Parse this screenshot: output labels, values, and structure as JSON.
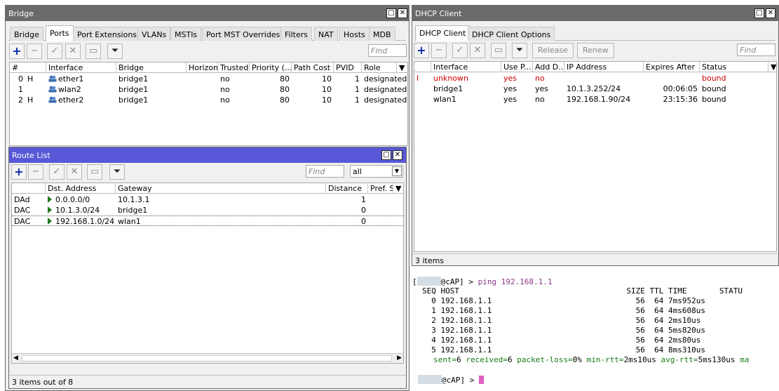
{
  "bridge": {
    "title": "Bridge",
    "tabs": [
      "Bridge",
      "Ports",
      "Port Extensions",
      "VLANs",
      "MSTIs",
      "Port MST Overrides",
      "Filters",
      "NAT",
      "Hosts",
      "MDB"
    ],
    "find_placeholder": "Find",
    "columns": [
      "#",
      "Interface",
      "Bridge",
      "Horizon",
      "Trusted",
      "Priority (...",
      "Path Cost",
      "PVID",
      "Role"
    ],
    "rows": [
      {
        "num": "0",
        "flag": "H",
        "interface": "ether1",
        "bridge": "bridge1",
        "horizon": "",
        "trusted": "no",
        "priority": "80",
        "path_cost": "10",
        "pvid": "1",
        "role": "designated p"
      },
      {
        "num": "1",
        "flag": "",
        "interface": "wlan2",
        "bridge": "bridge1",
        "horizon": "",
        "trusted": "no",
        "priority": "80",
        "path_cost": "10",
        "pvid": "1",
        "role": "designated p"
      },
      {
        "num": "2",
        "flag": "H",
        "interface": "ether2",
        "bridge": "bridge1",
        "horizon": "",
        "trusted": "no",
        "priority": "80",
        "path_cost": "10",
        "pvid": "1",
        "role": "designated p"
      }
    ]
  },
  "route_list": {
    "title": "Route List",
    "find_placeholder": "Find",
    "filter_value": "all",
    "columns": [
      "Dst. Address",
      "Gateway",
      "Distance",
      "Pref. S"
    ],
    "rows": [
      {
        "flags": "DAd",
        "dst": "0.0.0.0/0",
        "gateway": "10.1.3.1",
        "distance": "1"
      },
      {
        "flags": "DAC",
        "dst": "10.1.3.0/24",
        "gateway": "bridge1",
        "distance": "0"
      },
      {
        "flags": "DAC",
        "dst": "192.168.1.0/24",
        "gateway": "wlan1",
        "distance": "0"
      }
    ],
    "status": "3 items out of 8"
  },
  "dhcp": {
    "title": "DHCP Client",
    "tabs": [
      "DHCP Client",
      "DHCP Client Options"
    ],
    "release_label": "Release",
    "renew_label": "Renew",
    "find_placeholder": "Find",
    "columns": [
      "Interface",
      "Use P...",
      "Add D...",
      "IP Address",
      "Expires After",
      "Status"
    ],
    "rows": [
      {
        "flag": "I",
        "interface": "unknown",
        "use_peer": "yes",
        "add_default": "no",
        "ip": "",
        "expires": "",
        "status": "bound",
        "invalid": true
      },
      {
        "flag": "",
        "interface": "bridge1",
        "use_peer": "yes",
        "add_default": "yes",
        "ip": "10.1.3.252/24",
        "expires": "00:06:05",
        "status": "bound",
        "invalid": false
      },
      {
        "flag": "",
        "interface": "wlan1",
        "use_peer": "yes",
        "add_default": "no",
        "ip": "192.168.1.90/24",
        "expires": "23:15:36",
        "status": "bound",
        "invalid": false
      }
    ],
    "status": "3 items"
  },
  "terminal": {
    "prompt_host": "@cAP] >",
    "command": "ping 192.168.1.1",
    "header": "SEQ HOST                                    SIZE TTL TIME       STATU",
    "lines": [
      "  0 192.168.1.1                               56  64 7ms952us",
      "  1 192.168.1.1                               56  64 4ms608us",
      "  2 192.168.1.1                               56  64 2ms10us",
      "  3 192.168.1.1                               56  64 5ms820us",
      "  4 192.168.1.1                               56  64 2ms80us",
      "  5 192.168.1.1                               56  64 8ms310us"
    ],
    "summary": {
      "sent_key": "sent=",
      "sent": "6",
      "received_key": " received=",
      "received": "6",
      "loss_key": " packet-loss=",
      "loss": "0%",
      "min_key": " min-rtt=",
      "min": "2ms10us",
      "avg_key": " avg-rtt=",
      "avg": "5ms130us",
      "max_key": " ma"
    },
    "final_prompt": "@cAP] >"
  },
  "colors": {
    "accent_blue_titlebar": "#5858d8",
    "inactive_titlebar": "#6a6a6a",
    "invalid_red": "#d00000",
    "terminal_green": "#1a7a1a"
  }
}
